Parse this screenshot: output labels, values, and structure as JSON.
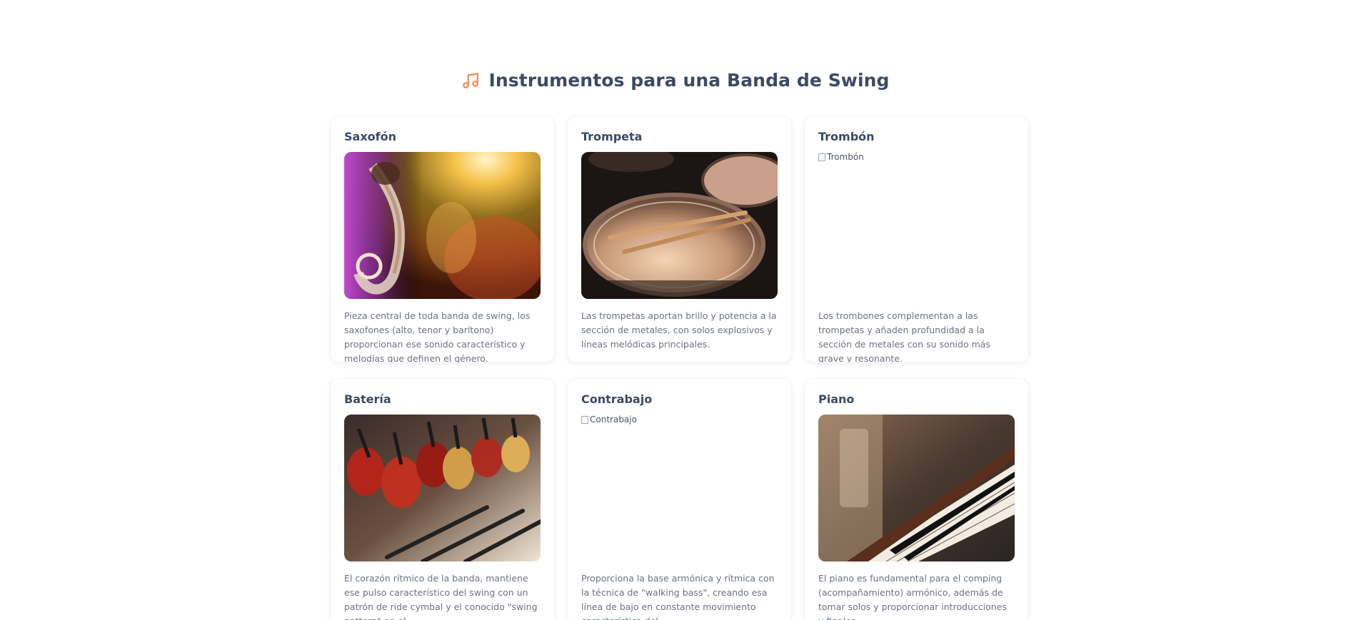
{
  "page": {
    "title": "Instrumentos para una Banda de Swing",
    "title_icon": "music-note-icon",
    "accent_color": "#f4884b"
  },
  "cards": [
    {
      "title": "Saxofón",
      "image_alt": "Saxofón",
      "image_loaded": true,
      "image_subject": "saxophone-concert-photo",
      "description": "Pieza central de toda banda de swing, los saxofones (alto, tenor y barítono) proporcionan ese sonido característico y melodías que definen el género."
    },
    {
      "title": "Trompeta",
      "image_alt": "Trompeta",
      "image_loaded": true,
      "image_subject": "drum-and-sticks-photo",
      "description": "Las trompetas aportan brillo y potencia a la sección de metales, con solos explosivos y líneas melódicas principales."
    },
    {
      "title": "Trombón",
      "image_alt": "Trombón",
      "image_loaded": false,
      "image_subject": "broken-image",
      "description": "Los trombones complementan a las trompetas y añaden profundidad a la sección de metales con su sonido más grave y resonante."
    },
    {
      "title": "Batería",
      "image_alt": "Batería",
      "image_loaded": true,
      "image_subject": "guitar-rack-photo",
      "description": "El corazón rítmico de la banda, mantiene ese pulso característico del swing con un patrón de ride cymbal y el conocido \"swing pattern\" en el"
    },
    {
      "title": "Contrabajo",
      "image_alt": "Contrabajo",
      "image_loaded": false,
      "image_subject": "broken-image",
      "description": "Proporciona la base armónica y rítmica con la técnica de \"walking bass\", creando esa línea de bajo en constante movimiento característica del"
    },
    {
      "title": "Piano",
      "image_alt": "Piano",
      "image_loaded": true,
      "image_subject": "piano-keys-photo",
      "description": "El piano es fundamental para el comping (acompañamiento) armónico, además de tomar solos y proporcionar introducciones y finales."
    }
  ]
}
